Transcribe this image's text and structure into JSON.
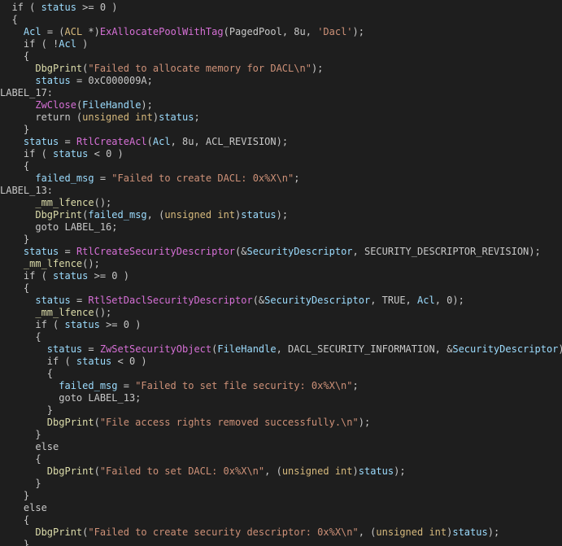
{
  "colors": {
    "background": "#1e1e1e",
    "default": "#c8c8c8",
    "variable": "#9cdcfe",
    "function": "#d670d6",
    "debug_call": "#dcdcaa",
    "string": "#ce9178",
    "type": "#d7ba7d"
  },
  "lines": [
    [
      {
        "k": "default",
        "t": "  if ( "
      },
      {
        "k": "var",
        "t": "status"
      },
      {
        "k": "default",
        "t": " >= 0 )"
      }
    ],
    [
      {
        "k": "default",
        "t": "  {"
      }
    ],
    [
      {
        "k": "default",
        "t": "    "
      },
      {
        "k": "var",
        "t": "Acl"
      },
      {
        "k": "default",
        "t": " = ("
      },
      {
        "k": "type",
        "t": "ACL"
      },
      {
        "k": "default",
        "t": " *)"
      },
      {
        "k": "func",
        "t": "ExAllocatePoolWithTag"
      },
      {
        "k": "default",
        "t": "(PagedPool, 8u, "
      },
      {
        "k": "str",
        "t": "'Dacl'"
      },
      {
        "k": "default",
        "t": ");"
      }
    ],
    [
      {
        "k": "default",
        "t": "    if ( !"
      },
      {
        "k": "var",
        "t": "Acl"
      },
      {
        "k": "default",
        "t": " )"
      }
    ],
    [
      {
        "k": "default",
        "t": "    {"
      }
    ],
    [
      {
        "k": "default",
        "t": "      "
      },
      {
        "k": "call",
        "t": "DbgPrint"
      },
      {
        "k": "default",
        "t": "("
      },
      {
        "k": "str",
        "t": "\"Failed to allocate memory for DACL\\n\""
      },
      {
        "k": "default",
        "t": ");"
      }
    ],
    [
      {
        "k": "default",
        "t": "      "
      },
      {
        "k": "var",
        "t": "status"
      },
      {
        "k": "default",
        "t": " = 0xC000009A;"
      }
    ],
    [
      {
        "k": "default",
        "t": "LABEL_17:"
      }
    ],
    [
      {
        "k": "default",
        "t": "      "
      },
      {
        "k": "func",
        "t": "ZwClose"
      },
      {
        "k": "default",
        "t": "("
      },
      {
        "k": "var",
        "t": "FileHandle"
      },
      {
        "k": "default",
        "t": ");"
      }
    ],
    [
      {
        "k": "default",
        "t": "      return ("
      },
      {
        "k": "type",
        "t": "unsigned int"
      },
      {
        "k": "default",
        "t": ")"
      },
      {
        "k": "var",
        "t": "status"
      },
      {
        "k": "default",
        "t": ";"
      }
    ],
    [
      {
        "k": "default",
        "t": "    }"
      }
    ],
    [
      {
        "k": "default",
        "t": "    "
      },
      {
        "k": "var",
        "t": "status"
      },
      {
        "k": "default",
        "t": " = "
      },
      {
        "k": "func",
        "t": "RtlCreateAcl"
      },
      {
        "k": "default",
        "t": "("
      },
      {
        "k": "var",
        "t": "Acl"
      },
      {
        "k": "default",
        "t": ", 8u, ACL_REVISION);"
      }
    ],
    [
      {
        "k": "default",
        "t": "    if ( "
      },
      {
        "k": "var",
        "t": "status"
      },
      {
        "k": "default",
        "t": " < 0 )"
      }
    ],
    [
      {
        "k": "default",
        "t": "    {"
      }
    ],
    [
      {
        "k": "default",
        "t": "      "
      },
      {
        "k": "var",
        "t": "failed_msg"
      },
      {
        "k": "default",
        "t": " = "
      },
      {
        "k": "str",
        "t": "\"Failed to create DACL: 0x%X\\n\""
      },
      {
        "k": "default",
        "t": ";"
      }
    ],
    [
      {
        "k": "default",
        "t": "LABEL_13:"
      }
    ],
    [
      {
        "k": "default",
        "t": "      "
      },
      {
        "k": "call",
        "t": "_mm_lfence"
      },
      {
        "k": "default",
        "t": "();"
      }
    ],
    [
      {
        "k": "default",
        "t": "      "
      },
      {
        "k": "call",
        "t": "DbgPrint"
      },
      {
        "k": "default",
        "t": "("
      },
      {
        "k": "var",
        "t": "failed_msg"
      },
      {
        "k": "default",
        "t": ", ("
      },
      {
        "k": "type",
        "t": "unsigned int"
      },
      {
        "k": "default",
        "t": ")"
      },
      {
        "k": "var",
        "t": "status"
      },
      {
        "k": "default",
        "t": ");"
      }
    ],
    [
      {
        "k": "default",
        "t": "      goto LABEL_16;"
      }
    ],
    [
      {
        "k": "default",
        "t": "    }"
      }
    ],
    [
      {
        "k": "default",
        "t": "    "
      },
      {
        "k": "var",
        "t": "status"
      },
      {
        "k": "default",
        "t": " = "
      },
      {
        "k": "func",
        "t": "RtlCreateSecurityDescriptor"
      },
      {
        "k": "default",
        "t": "(&"
      },
      {
        "k": "var",
        "t": "SecurityDescriptor"
      },
      {
        "k": "default",
        "t": ", SECURITY_DESCRIPTOR_REVISION);"
      }
    ],
    [
      {
        "k": "default",
        "t": "    "
      },
      {
        "k": "call",
        "t": "_mm_lfence"
      },
      {
        "k": "default",
        "t": "();"
      }
    ],
    [
      {
        "k": "default",
        "t": "    if ( "
      },
      {
        "k": "var",
        "t": "status"
      },
      {
        "k": "default",
        "t": " >= 0 )"
      }
    ],
    [
      {
        "k": "default",
        "t": "    {"
      }
    ],
    [
      {
        "k": "default",
        "t": "      "
      },
      {
        "k": "var",
        "t": "status"
      },
      {
        "k": "default",
        "t": " = "
      },
      {
        "k": "func",
        "t": "RtlSetDaclSecurityDescriptor"
      },
      {
        "k": "default",
        "t": "(&"
      },
      {
        "k": "var",
        "t": "SecurityDescriptor"
      },
      {
        "k": "default",
        "t": ", TRUE, "
      },
      {
        "k": "var",
        "t": "Acl"
      },
      {
        "k": "default",
        "t": ", 0);"
      }
    ],
    [
      {
        "k": "default",
        "t": "      "
      },
      {
        "k": "call",
        "t": "_mm_lfence"
      },
      {
        "k": "default",
        "t": "();"
      }
    ],
    [
      {
        "k": "default",
        "t": "      if ( "
      },
      {
        "k": "var",
        "t": "status"
      },
      {
        "k": "default",
        "t": " >= 0 )"
      }
    ],
    [
      {
        "k": "default",
        "t": "      {"
      }
    ],
    [
      {
        "k": "default",
        "t": "        "
      },
      {
        "k": "var",
        "t": "status"
      },
      {
        "k": "default",
        "t": " = "
      },
      {
        "k": "func",
        "t": "ZwSetSecurityObject"
      },
      {
        "k": "default",
        "t": "("
      },
      {
        "k": "var",
        "t": "FileHandle"
      },
      {
        "k": "default",
        "t": ", DACL_SECURITY_INFORMATION, &"
      },
      {
        "k": "var",
        "t": "SecurityDescriptor"
      },
      {
        "k": "default",
        "t": ");"
      }
    ],
    [
      {
        "k": "default",
        "t": "        if ( "
      },
      {
        "k": "var",
        "t": "status"
      },
      {
        "k": "default",
        "t": " < 0 )"
      }
    ],
    [
      {
        "k": "default",
        "t": "        {"
      }
    ],
    [
      {
        "k": "default",
        "t": "          "
      },
      {
        "k": "var",
        "t": "failed_msg"
      },
      {
        "k": "default",
        "t": " = "
      },
      {
        "k": "str",
        "t": "\"Failed to set file security: 0x%X\\n\""
      },
      {
        "k": "default",
        "t": ";"
      }
    ],
    [
      {
        "k": "default",
        "t": "          goto LABEL_13;"
      }
    ],
    [
      {
        "k": "default",
        "t": "        }"
      }
    ],
    [
      {
        "k": "default",
        "t": "        "
      },
      {
        "k": "call",
        "t": "DbgPrint"
      },
      {
        "k": "default",
        "t": "("
      },
      {
        "k": "str",
        "t": "\"File access rights removed successfully.\\n\""
      },
      {
        "k": "default",
        "t": ");"
      }
    ],
    [
      {
        "k": "default",
        "t": "      }"
      }
    ],
    [
      {
        "k": "default",
        "t": "      else"
      }
    ],
    [
      {
        "k": "default",
        "t": "      {"
      }
    ],
    [
      {
        "k": "default",
        "t": "        "
      },
      {
        "k": "call",
        "t": "DbgPrint"
      },
      {
        "k": "default",
        "t": "("
      },
      {
        "k": "str",
        "t": "\"Failed to set DACL: 0x%X\\n\""
      },
      {
        "k": "default",
        "t": ", ("
      },
      {
        "k": "type",
        "t": "unsigned int"
      },
      {
        "k": "default",
        "t": ")"
      },
      {
        "k": "var",
        "t": "status"
      },
      {
        "k": "default",
        "t": ");"
      }
    ],
    [
      {
        "k": "default",
        "t": "      }"
      }
    ],
    [
      {
        "k": "default",
        "t": "    }"
      }
    ],
    [
      {
        "k": "default",
        "t": "    else"
      }
    ],
    [
      {
        "k": "default",
        "t": "    {"
      }
    ],
    [
      {
        "k": "default",
        "t": "      "
      },
      {
        "k": "call",
        "t": "DbgPrint"
      },
      {
        "k": "default",
        "t": "("
      },
      {
        "k": "str",
        "t": "\"Failed to create security descriptor: 0x%X\\n\""
      },
      {
        "k": "default",
        "t": ", ("
      },
      {
        "k": "type",
        "t": "unsigned int"
      },
      {
        "k": "default",
        "t": ")"
      },
      {
        "k": "var",
        "t": "status"
      },
      {
        "k": "default",
        "t": ");"
      }
    ],
    [
      {
        "k": "default",
        "t": "    }"
      }
    ]
  ]
}
